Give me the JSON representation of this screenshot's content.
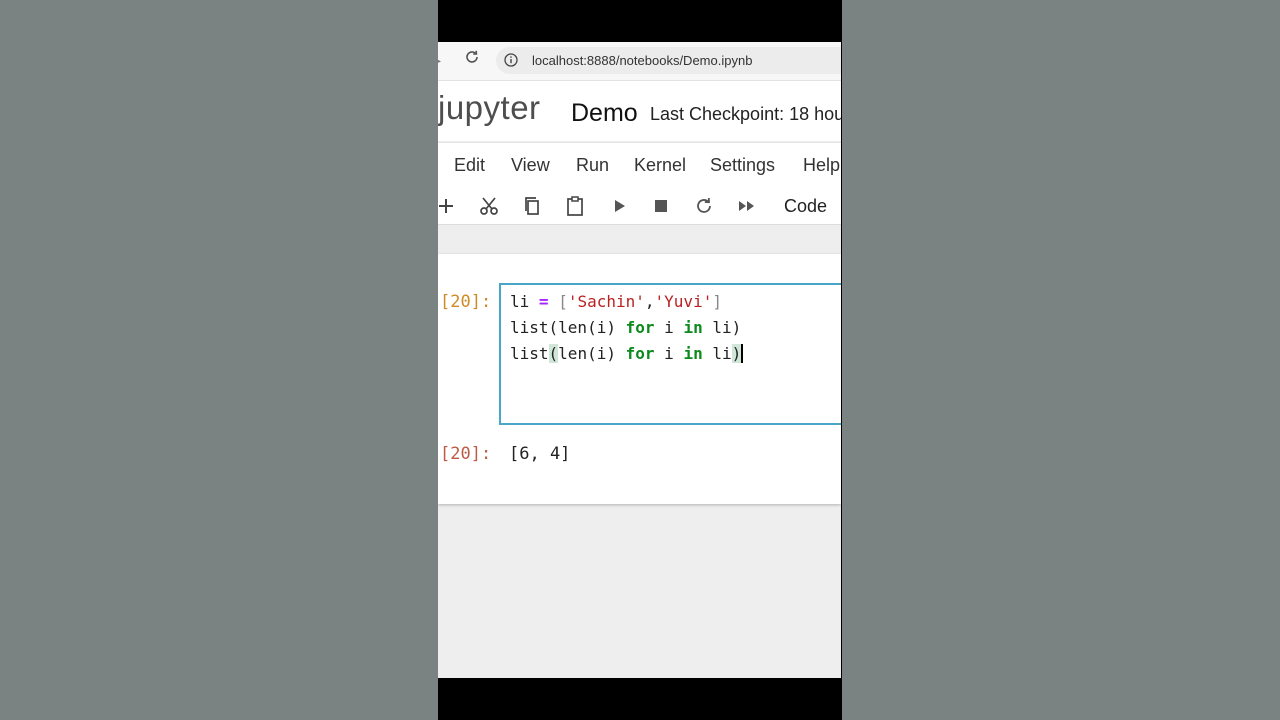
{
  "browser": {
    "url": "localhost:8888/notebooks/Demo.ipynb"
  },
  "header": {
    "logo_text": "jupyter",
    "notebook_title": "Demo",
    "checkpoint": "Last Checkpoint: 18 hou"
  },
  "menu": {
    "items": [
      {
        "label": "Edit"
      },
      {
        "label": "View"
      },
      {
        "label": "Run"
      },
      {
        "label": "Kernel"
      },
      {
        "label": "Settings"
      },
      {
        "label": "Help"
      }
    ]
  },
  "toolbar": {
    "icons": [
      "add-cell-icon",
      "cut-icon",
      "copy-icon",
      "paste-icon",
      "run-icon",
      "stop-icon",
      "restart-icon",
      "fast-forward-icon"
    ],
    "cell_type": "Code"
  },
  "cell": {
    "in_prompt": "[20]:",
    "out_prompt": "[20]:",
    "code": {
      "line1": {
        "var": "li",
        "op": "=",
        "open": "[",
        "str1": "'Sachin'",
        "comma": ",",
        "str2": "'Yuvi'",
        "close": "]"
      },
      "line2": {
        "pre": "list(len(i)",
        "kw_for": "for",
        "mid": "i",
        "kw_in": "in",
        "post": "li)"
      },
      "line3": {
        "pre": "list",
        "open_paren": "(",
        "inner": "len(i)",
        "kw_for": "for",
        "mid": "i",
        "kw_in": "in",
        "post": "li",
        "close_paren": ")"
      }
    },
    "output": "[6, 4]"
  },
  "colors": {
    "accent_border": "#4aa6c8",
    "in_prompt": "#d08a26",
    "out_prompt": "#bd5b45",
    "keyword": "#0d8a1e",
    "string": "#ba2121",
    "operator": "#aa22ff"
  }
}
